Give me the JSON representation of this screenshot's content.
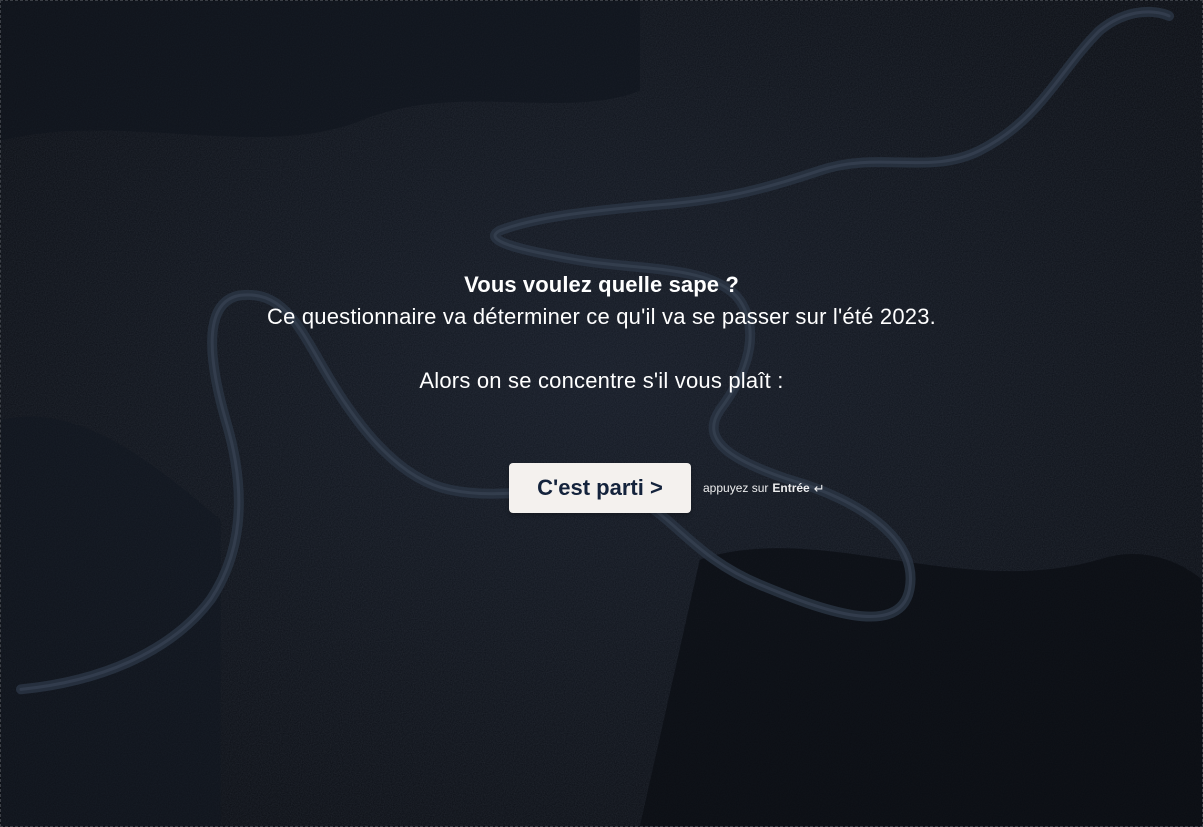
{
  "intro": {
    "title": "Vous voulez quelle sape ?",
    "description": "Ce questionnaire va déterminer ce qu'il va se passer sur l'été 2023.",
    "prompt": "Alors on se concentre s'il vous plaît :"
  },
  "cta": {
    "button_label": "C'est parti >",
    "hint_prefix": "appuyez sur",
    "hint_key": "Entrée",
    "hint_icon": "↵"
  },
  "colors": {
    "background": "#0d1016",
    "button_bg": "#f4f1ee",
    "button_text": "#14233c",
    "text": "#ffffff"
  }
}
